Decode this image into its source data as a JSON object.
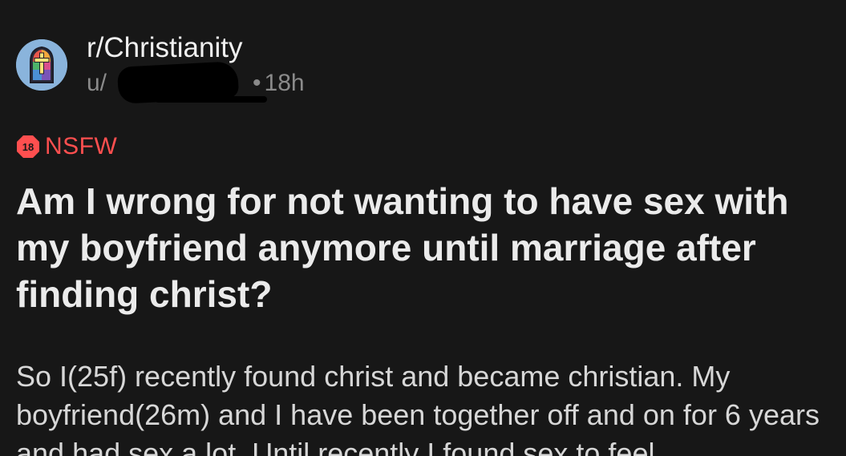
{
  "post": {
    "subreddit": "r/Christianity",
    "author_prefix": "u/",
    "separator": "•",
    "age": "18h",
    "nsfw_badge_number": "18",
    "nsfw_label": "NSFW",
    "title": "Am I wrong for not wanting to have sex with my boyfriend anymore until marriage after finding christ?",
    "body": "So I(25f) recently found christ and became christian. My boyfriend(26m) and I have been together off and on for 6 years and had sex a lot. Until recently I found sex to feel"
  },
  "colors": {
    "background": "#171717",
    "nsfw_red": "#ff4f4f",
    "avatar_blue": "#8ab4dc"
  },
  "icons": {
    "avatar": "stained-glass-cross-icon",
    "nsfw": "nsfw-18-icon"
  }
}
